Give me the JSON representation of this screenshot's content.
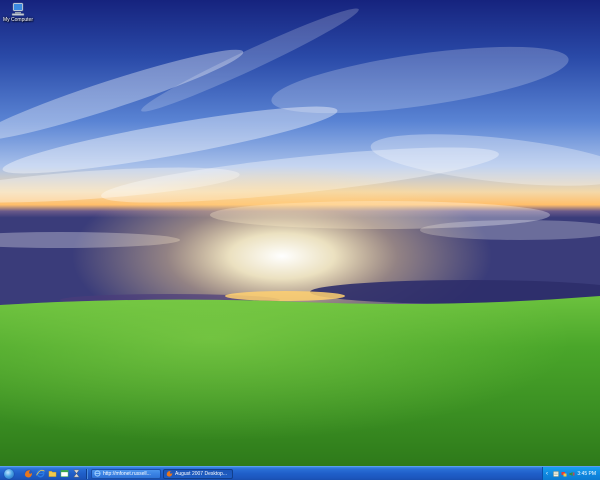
{
  "desktop": {
    "icons": [
      {
        "label": "My Computer",
        "icon": "my-computer-icon"
      }
    ]
  },
  "taskbar": {
    "start_icon": "windows-orb-icon",
    "quicklaunch": [
      {
        "icon": "firefox-icon",
        "color": "#e8761c"
      },
      {
        "icon": "internet-explorer-icon",
        "color": "#2a7be4"
      },
      {
        "icon": "folder-icon",
        "color": "#f2c94c"
      },
      {
        "icon": "window-icon",
        "color": "#3aa84a"
      },
      {
        "icon": "hourglass-icon",
        "color": "#dcdcdc"
      }
    ],
    "tasks": [
      {
        "label": "http://mfonet.russell...",
        "icon": "internet-explorer-icon",
        "active": false
      },
      {
        "label": "August 2007 Desktop...",
        "icon": "firefox-icon",
        "active": true
      }
    ],
    "tray": {
      "chevron": "‹",
      "icons": [
        {
          "icon": "notepad-icon",
          "color": "#f4f4e8"
        },
        {
          "icon": "network-icon",
          "color": "#e23b3b"
        },
        {
          "icon": "volume-icon",
          "color": "#3b8a3b"
        }
      ],
      "clock": "3:45 PM"
    }
  },
  "colors": {
    "sky_top": "#1a2a8c",
    "sky_mid": "#4a78d0",
    "horizon_glow": "#ffd48a",
    "grass": "#4aa12e",
    "taskbar": "#1f5fc9",
    "tray": "#0f88e0"
  }
}
